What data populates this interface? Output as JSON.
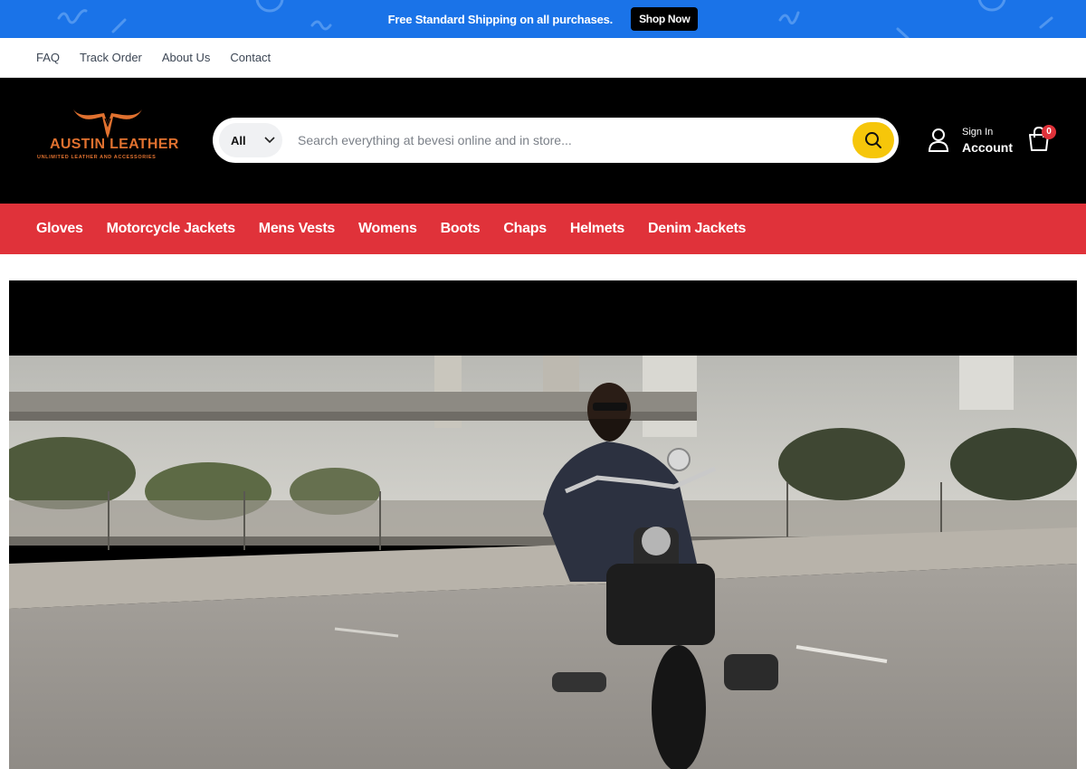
{
  "announcement": {
    "text": "Free Standard Shipping on all purchases.",
    "cta_label": "Shop Now"
  },
  "top_links": [
    "FAQ",
    "Track Order",
    "About Us",
    "Contact"
  ],
  "brand": {
    "name": "AUSTIN LEATHER",
    "tagline": "UNLIMITED LEATHER AND ACCESSORIES"
  },
  "search": {
    "category": "All",
    "placeholder": "Search everything at bevesi online and in store..."
  },
  "account": {
    "signin": "Sign In",
    "label": "Account"
  },
  "cart": {
    "count": "0"
  },
  "categories": [
    "Gloves",
    "Motorcycle Jackets",
    "Mens Vests",
    "Womens",
    "Boots",
    "Chaps",
    "Helmets",
    "Denim Jackets"
  ],
  "colors": {
    "announcement_bg": "#1a73e8",
    "header_bg": "#000000",
    "nav_bg": "#e0323a",
    "search_button": "#f6c60a",
    "brand": "#e0712f"
  },
  "icons": {
    "search": "search-icon",
    "dropdown": "chevron-down-icon",
    "account": "user-icon",
    "cart": "shopping-bag-icon"
  }
}
